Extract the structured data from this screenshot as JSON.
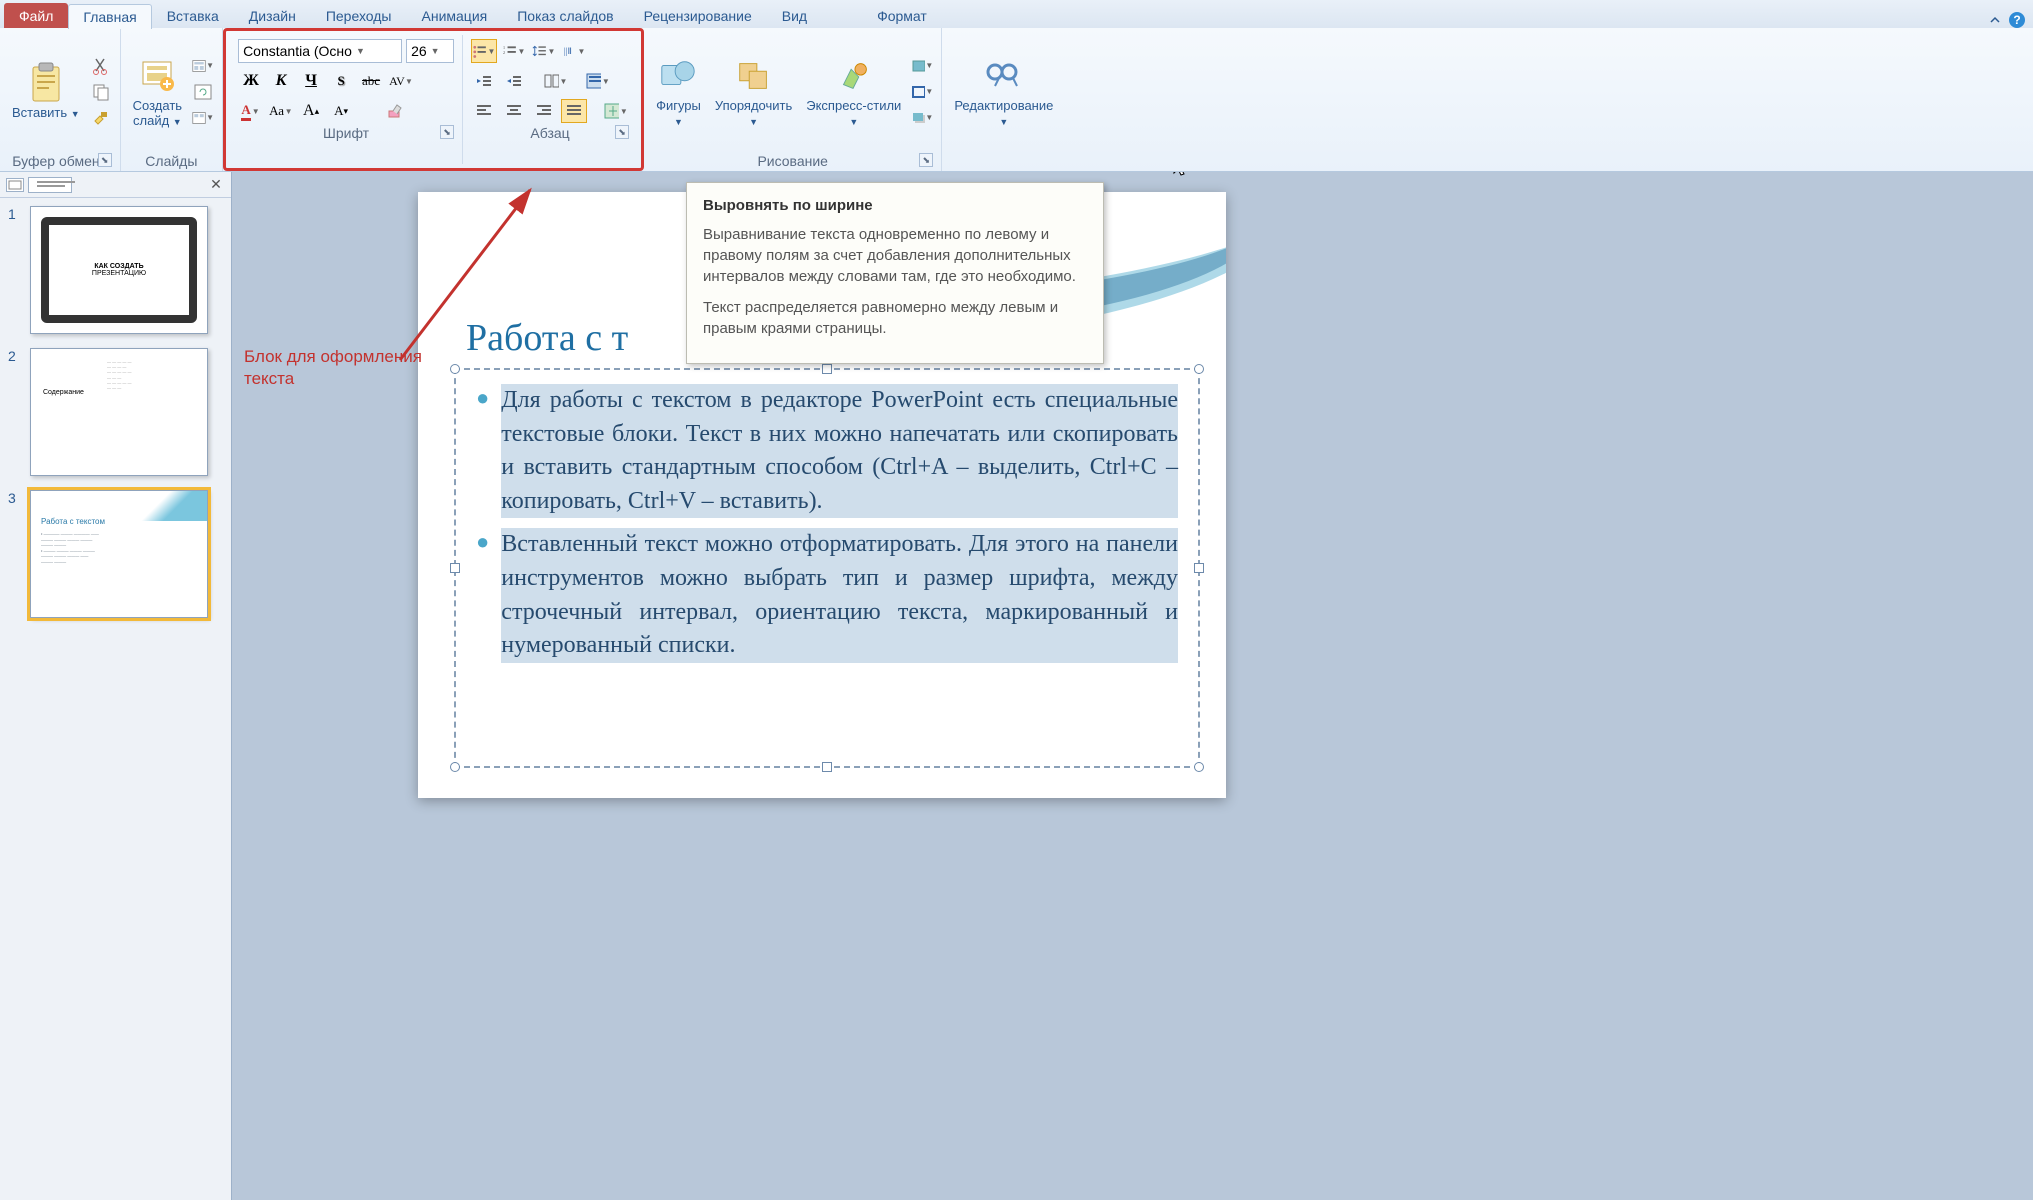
{
  "tabs": {
    "file": "Файл",
    "home": "Главная",
    "insert": "Вставка",
    "design": "Дизайн",
    "transitions": "Переходы",
    "animation": "Анимация",
    "slideshow": "Показ слайдов",
    "review": "Рецензирование",
    "view": "Вид",
    "format": "Формат"
  },
  "ribbon": {
    "clipboard": {
      "label": "Буфер обмена",
      "paste": "Вставить"
    },
    "slides": {
      "label": "Слайды",
      "new_slide_1": "Создать",
      "new_slide_2": "слайд"
    },
    "font": {
      "label": "Шрифт",
      "name": "Constantia (Осно",
      "size": "26",
      "bold": "Ж",
      "italic": "К",
      "underline": "Ч",
      "strike": "abc",
      "shadow": "S",
      "spacing": "AV",
      "color": "А",
      "case": "Аа",
      "grow": "А",
      "shrink": "А",
      "clear": "🧹"
    },
    "paragraph": {
      "label": "Абзац"
    },
    "drawing": {
      "label": "Рисование",
      "shapes": "Фигуры",
      "arrange": "Упорядочить",
      "quick_styles": "Экспресс-стили"
    },
    "editing": {
      "label": "Редактирование"
    }
  },
  "tooltip": {
    "title": "Выровнять по ширине",
    "p1": "Выравнивание текста одновременно по левому и правому полям за счет добавления дополнительных интервалов между словами там, где это необходимо.",
    "p2": "Текст распределяется равномерно между левым и правым краями страницы."
  },
  "annotation": {
    "line1": "Блок для оформления",
    "line2": "текста"
  },
  "slide": {
    "title": "Работа с т",
    "bullet1": "Для работы с текстом в редакторе PowerPoint есть специальные текстовые блоки. Текст в них можно напечатать или скопировать и вставить стандартным способом (Ctrl+A – выделить, Ctrl+C – копировать, Ctrl+V – вставить).",
    "bullet2": "Вставленный текст можно отформатировать. Для этого на панели инструментов можно выбрать тип и размер шрифта, между строчечный интервал, ориентацию текста, маркированный и нумерованный списки."
  },
  "thumbs": {
    "t1": {
      "title": "КАК СОЗДАТЬ",
      "sub": "ПРЕЗЕНТАЦИЮ"
    },
    "t2_title": "Содержание",
    "t3_title": "Работа с текстом"
  }
}
